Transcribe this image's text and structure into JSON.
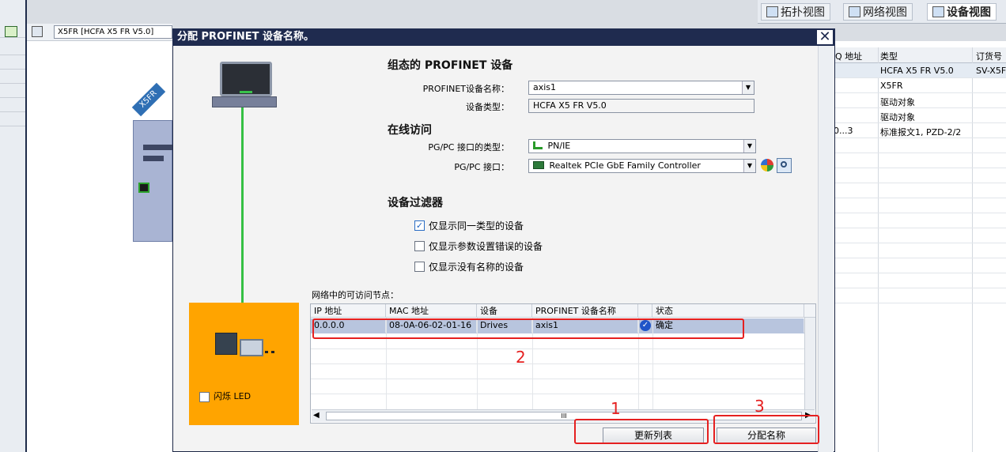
{
  "view_tabs": [
    {
      "label": "拓扑视图",
      "icon": "topology-icon",
      "active": false
    },
    {
      "label": "网络视图",
      "icon": "network-icon",
      "active": false
    },
    {
      "label": "设备视图",
      "icon": "device-view-icon",
      "active": true
    }
  ],
  "editor": {
    "device_select": "X5FR [HCFA X5 FR V5.0]",
    "device_tag": "X5FR"
  },
  "overview": {
    "headers": [
      "Q 地址",
      "类型",
      "订货号"
    ],
    "rows": [
      {
        "addr": "",
        "type": "HCFA X5 FR V5.0",
        "order": "SV-X5F"
      },
      {
        "addr": "",
        "type": "X5FR",
        "order": ""
      },
      {
        "addr": "",
        "type": "驱动对象",
        "order": ""
      },
      {
        "addr": "",
        "type": "驱动对象",
        "order": ""
      },
      {
        "addr": "0...3",
        "type": "标准报文1, PZD-2/2",
        "order": ""
      }
    ]
  },
  "dialog": {
    "title": "分配 PROFINET 设备名称。",
    "close": "✕",
    "configured": {
      "title": "组态的 PROFINET 设备",
      "name_label": "PROFINET设备名称：",
      "name_value": "axis1",
      "type_label": "设备类型：",
      "type_value": "HCFA X5 FR V5.0"
    },
    "online": {
      "title": "在线访问",
      "iface_type_label": "PG/PC 接口的类型：",
      "iface_type_value": "PN/IE",
      "iface_label": "PG/PC 接口：",
      "iface_value": "Realtek PCIe GbE Family Controller"
    },
    "filter": {
      "title": "设备过滤器",
      "options": [
        {
          "label": "仅显示同一类型的设备",
          "checked": true
        },
        {
          "label": "仅显示参数设置错误的设备",
          "checked": false
        },
        {
          "label": "仅显示没有名称的设备",
          "checked": false
        }
      ]
    },
    "flash_led": "闪烁 LED",
    "nodes": {
      "caption": "网络中的可访问节点：",
      "headers": [
        "IP 地址",
        "MAC 地址",
        "设备",
        "PROFINET 设备名称",
        "状态"
      ],
      "rows": [
        {
          "ip": "0.0.0.0",
          "mac": "08-0A-06-02-01-16",
          "device": "Drives",
          "name": "axis1",
          "status": "确定"
        }
      ],
      "scroll_mark": "III"
    },
    "buttons": {
      "refresh": "更新列表",
      "assign": "分配名称"
    },
    "annotations": [
      "1",
      "2",
      "3"
    ]
  },
  "colors": {
    "title_bar": "#1f2b4f",
    "highlight": "#e52020",
    "orange_panel": "#ffa400",
    "link_line": "#35c043"
  }
}
